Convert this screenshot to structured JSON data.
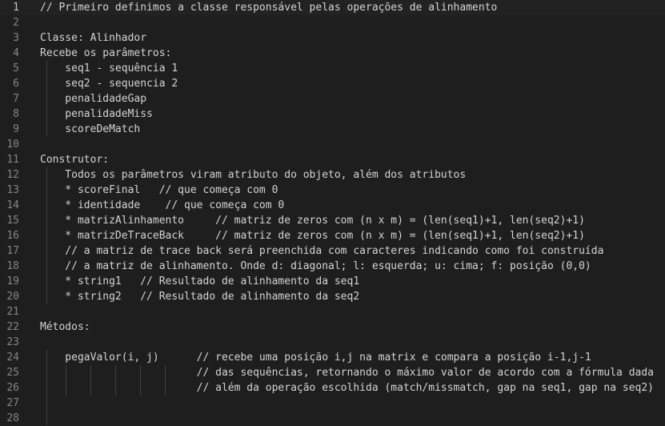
{
  "editor": {
    "current_line": 1,
    "lines": [
      {
        "n": "1",
        "text": "// Primeiro definimos a classe responsável pelas operações de alinhamento"
      },
      {
        "n": "2",
        "text": ""
      },
      {
        "n": "3",
        "text": "Classe: Alinhador"
      },
      {
        "n": "4",
        "text": "Recebe os parâmetros:"
      },
      {
        "n": "5",
        "text": "    seq1 - sequência 1"
      },
      {
        "n": "6",
        "text": "    seq2 - sequencia 2"
      },
      {
        "n": "7",
        "text": "    penalidadeGap"
      },
      {
        "n": "8",
        "text": "    penalidadeMiss"
      },
      {
        "n": "9",
        "text": "    scoreDeMatch"
      },
      {
        "n": "10",
        "text": ""
      },
      {
        "n": "11",
        "text": "Construtor:"
      },
      {
        "n": "12",
        "text": "    Todos os parâmetros viram atributo do objeto, além dos atributos"
      },
      {
        "n": "13",
        "text": "    * scoreFinal   // que começa com 0"
      },
      {
        "n": "14",
        "text": "    * identidade    // que começa com 0"
      },
      {
        "n": "15",
        "text": "    * matrizAlinhamento     // matriz de zeros com (n x m) = (len(seq1)+1, len(seq2)+1)"
      },
      {
        "n": "16",
        "text": "    * matrizDeTraceBack     // matriz de zeros com (n x m) = (len(seq1)+1, len(seq2)+1)"
      },
      {
        "n": "17",
        "text": "    // a matriz de trace back será preenchida com caracteres indicando como foi construída"
      },
      {
        "n": "18",
        "text": "    // a matriz de alinhamento. Onde d: diagonal; l: esquerda; u: cima; f: posição (0,0)"
      },
      {
        "n": "19",
        "text": "    * string1   // Resultado de alinhamento da seq1"
      },
      {
        "n": "20",
        "text": "    * string2   // Resultado de alinhamento da seq2"
      },
      {
        "n": "21",
        "text": ""
      },
      {
        "n": "22",
        "text": "Métodos:"
      },
      {
        "n": "23",
        "text": ""
      },
      {
        "n": "24",
        "text": "    pegaValor(i, j)      // recebe uma posição i,j na matrix e compara a posição i-1,j-1"
      },
      {
        "n": "25",
        "text": "                         // das sequências, retornando o máximo valor de acordo com a fórmula dada"
      },
      {
        "n": "26",
        "text": "                         // além da operação escolhida (match/missmatch, gap na seq1, gap na seq2)"
      },
      {
        "n": "27",
        "text": ""
      },
      {
        "n": "28",
        "text": ""
      }
    ]
  }
}
